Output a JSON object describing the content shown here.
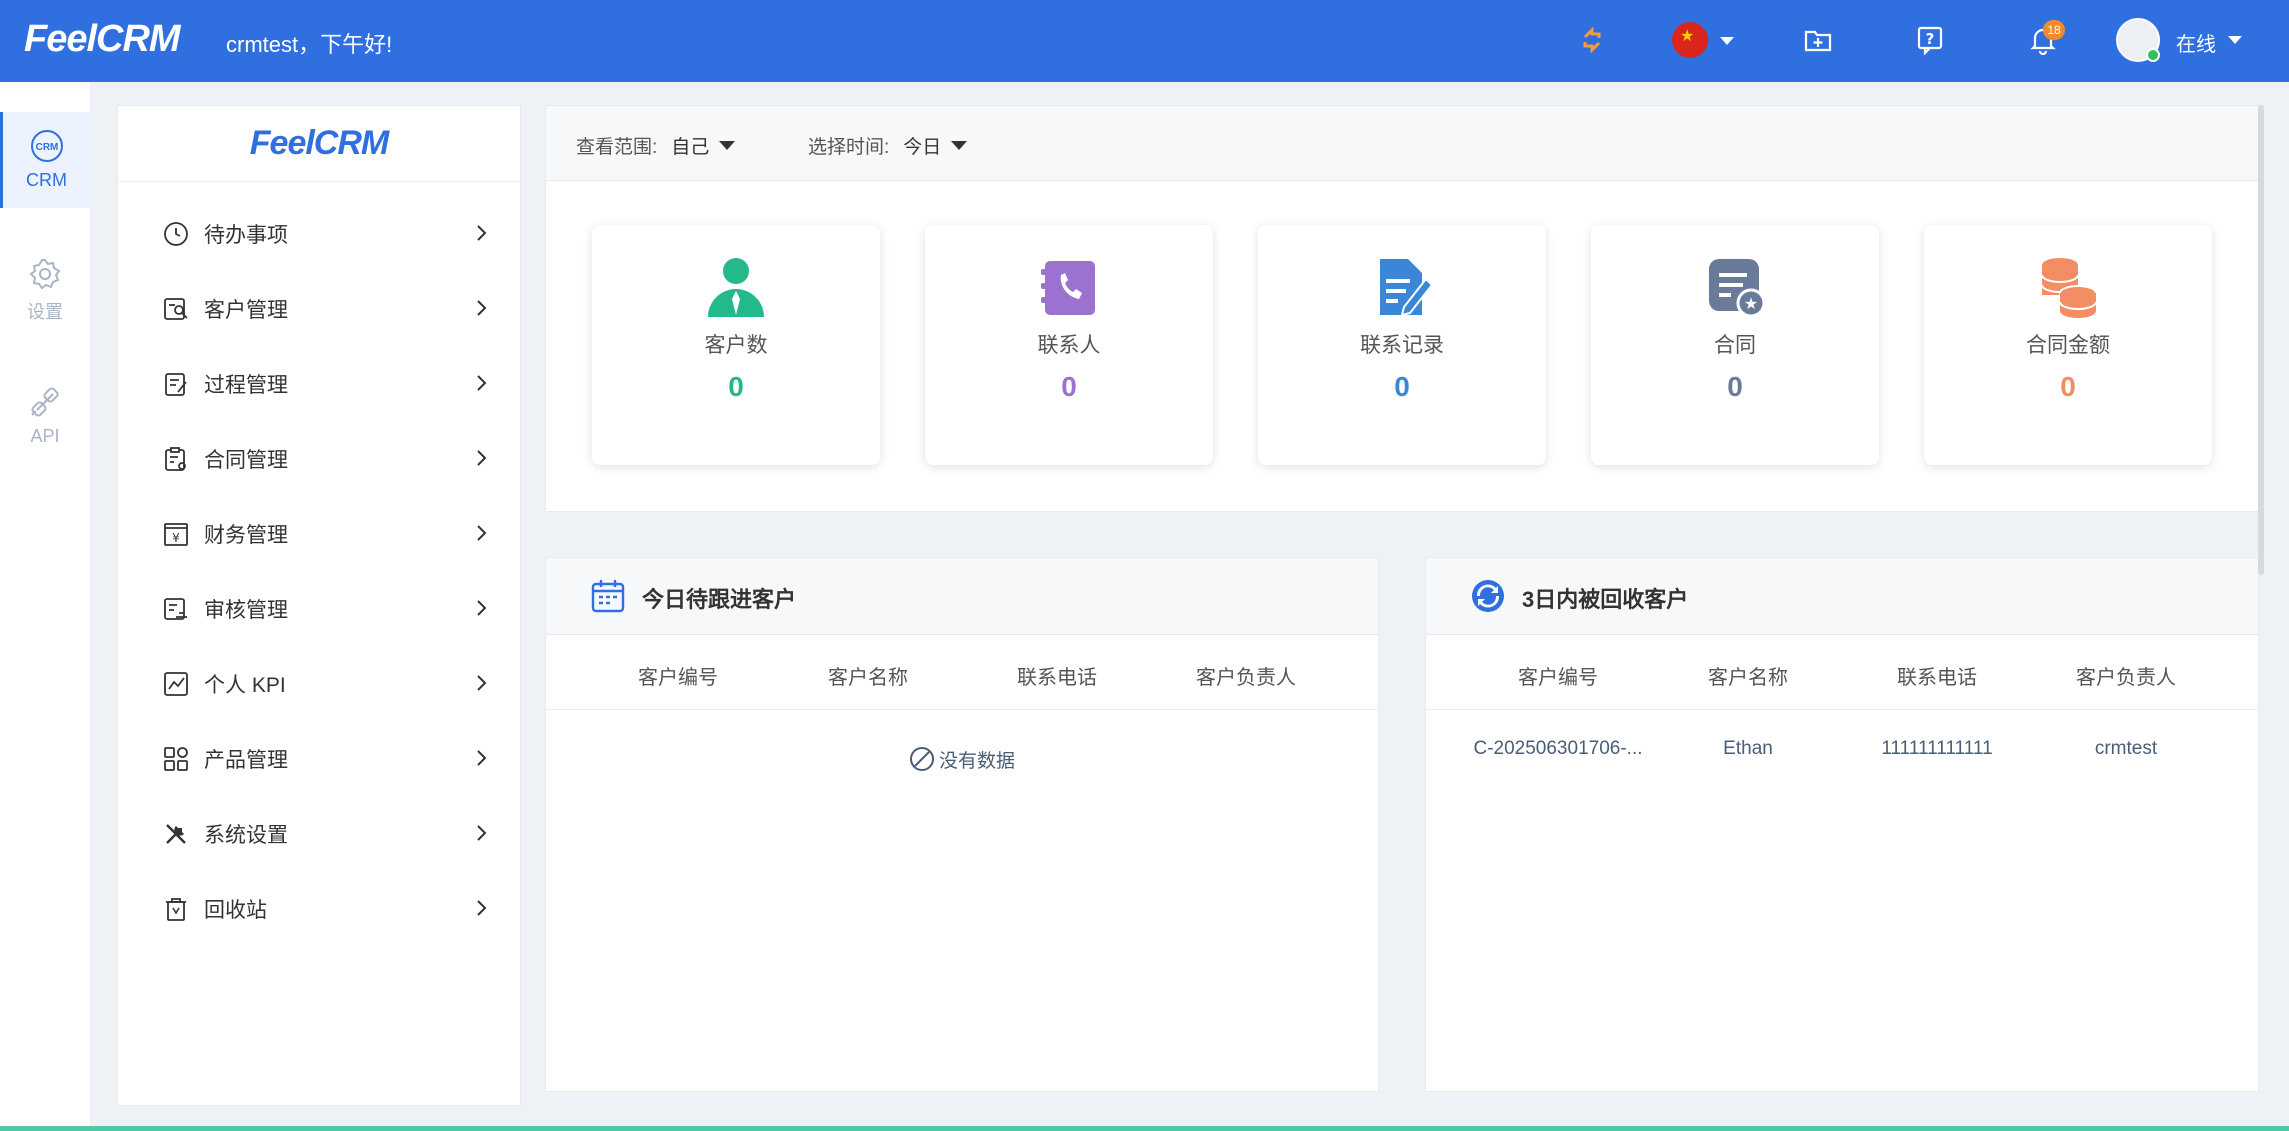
{
  "topbar": {
    "logo": "FeelCRM",
    "greeting": "crmtest，下午好!",
    "notification_count": "18",
    "status": "在线"
  },
  "rail": [
    {
      "label": "CRM",
      "icon": "crm-icon",
      "active": true
    },
    {
      "label": "设置",
      "icon": "gear-icon",
      "active": false
    },
    {
      "label": "API",
      "icon": "plug-icon",
      "active": false
    }
  ],
  "menu": {
    "logo": "FeelCRM",
    "items": [
      {
        "label": "待办事项",
        "icon": "clock-icon"
      },
      {
        "label": "客户管理",
        "icon": "customer-icon"
      },
      {
        "label": "过程管理",
        "icon": "process-icon"
      },
      {
        "label": "合同管理",
        "icon": "contract-icon"
      },
      {
        "label": "财务管理",
        "icon": "finance-icon"
      },
      {
        "label": "审核管理",
        "icon": "audit-icon"
      },
      {
        "label": "个人 KPI",
        "icon": "kpi-icon"
      },
      {
        "label": "产品管理",
        "icon": "product-icon"
      },
      {
        "label": "系统设置",
        "icon": "tools-icon"
      },
      {
        "label": "回收站",
        "icon": "trash-icon"
      }
    ]
  },
  "filters": {
    "scope_label": "查看范围:",
    "scope_value": "自己",
    "time_label": "选择时间:",
    "time_value": "今日"
  },
  "stats": [
    {
      "label": "客户数",
      "value": "0",
      "color": "#23b98a",
      "icon": "person-icon"
    },
    {
      "label": "联系人",
      "value": "0",
      "color": "#9b72cf",
      "icon": "phone-book-icon"
    },
    {
      "label": "联系记录",
      "value": "0",
      "color": "#3a87d9",
      "icon": "note-icon"
    },
    {
      "label": "合同",
      "value": "0",
      "color": "#6a7a99",
      "icon": "contract-star-icon"
    },
    {
      "label": "合同金额",
      "value": "0",
      "color": "#f38d63",
      "icon": "coins-icon"
    }
  ],
  "panels": {
    "followup": {
      "title": "今日待跟进客户",
      "columns": [
        "客户编号",
        "客户名称",
        "联系电话",
        "客户负责人"
      ],
      "empty_text": "没有数据"
    },
    "recycled": {
      "title": "3日内被回收客户",
      "columns": [
        "客户编号",
        "客户名称",
        "联系电话",
        "客户负责人"
      ],
      "rows": [
        [
          "C-202506301706-...",
          "Ethan",
          "111111111111",
          "crmtest"
        ]
      ]
    }
  }
}
